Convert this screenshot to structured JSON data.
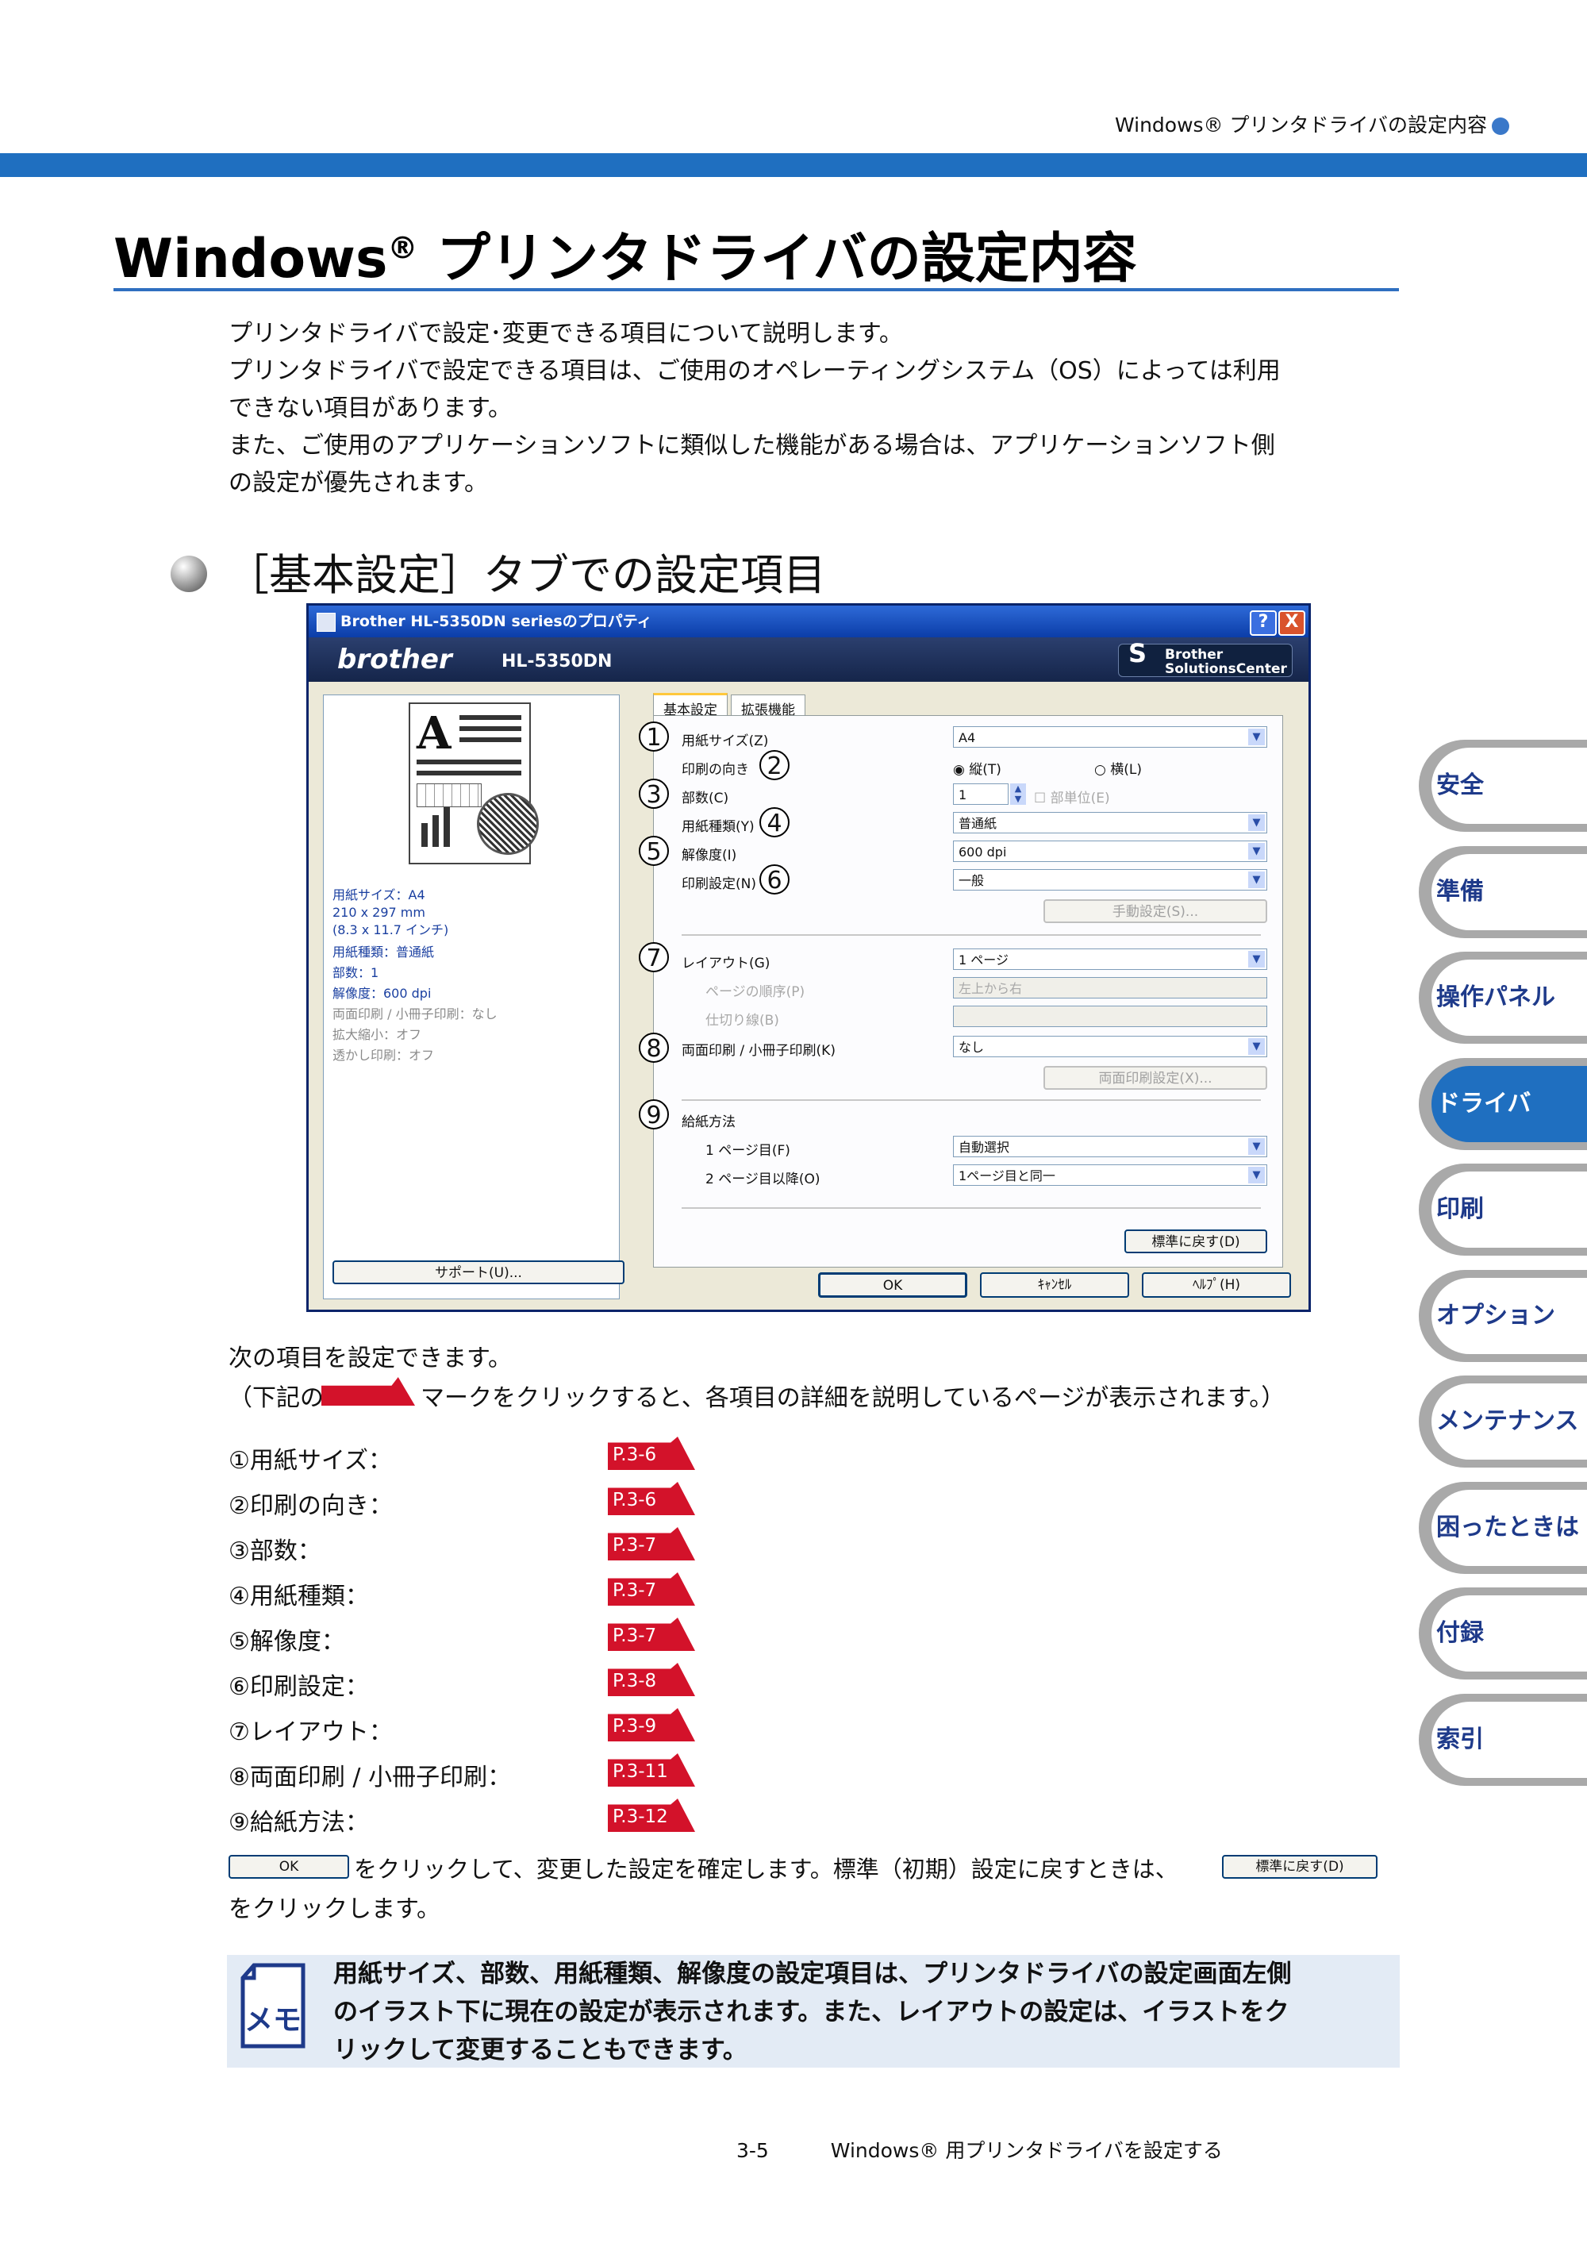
{
  "header": {
    "running_title": "Windows® プリンタドライバの設定内容"
  },
  "title": {
    "main": "Windows",
    "reg": "®",
    "rest": " プリンタドライバの設定内容"
  },
  "intro": [
    "プリンタドライバで設定･変更できる項目について説明します。",
    "プリンタドライバで設定できる項目は、ご使用のオペレーティングシステム（OS）によっては利用",
    "できない項目があります。",
    "また、ご使用のアプリケーションソフトに類似した機能がある場合は、アプリケーションソフト側",
    "の設定が優先されます。"
  ],
  "section_heading": "［基本設定］タブでの設定項目",
  "dialog": {
    "title": "Brother HL-5350DN seriesのプロパティ",
    "help_btn": "?",
    "close_btn": "X",
    "brand": "brother",
    "model": "HL-5350DN",
    "solutions_line1": "Brother",
    "solutions_line2": "SolutionsCenter",
    "tabs": [
      "基本設定",
      "拡張機能"
    ],
    "illus_letter": "A",
    "preview_info": [
      {
        "text": "用紙サイズ：A4",
        "dim": false
      },
      {
        "text": "210 x 297 mm",
        "dim": false
      },
      {
        "text": "(8.3 x 11.7 インチ)",
        "dim": false
      },
      {
        "text": "用紙種類：普通紙",
        "dim": false
      },
      {
        "text": "部数：1",
        "dim": false
      },
      {
        "text": "解像度：600 dpi",
        "dim": false
      },
      {
        "text": "両面印刷 / 小冊子印刷：なし",
        "dim": true
      },
      {
        "text": "拡大縮小：オフ",
        "dim": true
      },
      {
        "text": "透かし印刷：オフ",
        "dim": true
      }
    ],
    "support_button": "サポート(U)...",
    "fields": {
      "paper_size_label": "用紙サイズ(Z)",
      "paper_size_value": "A4",
      "orientation_label": "印刷の向き",
      "portrait": "縦(T)",
      "landscape": "横(L)",
      "copies_label": "部数(C)",
      "copies_value": "1",
      "collate": "部単位(E)",
      "media_label": "用紙種類(Y)",
      "media_value": "普通紙",
      "resolution_label": "解像度(I)",
      "resolution_value": "600 dpi",
      "print_setting_label": "印刷設定(N)",
      "print_setting_value": "一般",
      "manual_settings_btn": "手動設定(S)...",
      "layout_label": "レイアウト(G)",
      "layout_value": "1 ページ",
      "page_order_label": "ページの順序(P)",
      "page_order_value": "左上から右",
      "border_label": "仕切り線(B)",
      "border_value": "",
      "duplex_label": "両面印刷 / 小冊子印刷(K)",
      "duplex_value": "なし",
      "duplex_settings_btn": "両面印刷設定(X)...",
      "paper_source_label": "給紙方法",
      "first_page_label": "1 ページ目(F)",
      "first_page_value": "自動選択",
      "other_pages_label": "2 ページ目以降(O)",
      "other_pages_value": "1ページ目と同一",
      "default_btn": "標準に戻す(D)"
    },
    "numbers": [
      "1",
      "2",
      "3",
      "4",
      "5",
      "6",
      "7",
      "8",
      "9"
    ],
    "ok": "OK",
    "cancel": "ｷｬﾝｾﾙ",
    "help": "ﾍﾙﾌﾟ(H)"
  },
  "body": {
    "line1": "次の項目を設定できます。",
    "line2a": "（下記の",
    "line2b": "マークをクリックすると、各項目の詳細を説明しているページが表示されます。）",
    "items": [
      {
        "label": "①用紙サイズ：",
        "ref": "P.3-6"
      },
      {
        "label": "②印刷の向き：",
        "ref": "P.3-6"
      },
      {
        "label": "③部数：",
        "ref": "P.3-7"
      },
      {
        "label": "④用紙種類：",
        "ref": "P.3-7"
      },
      {
        "label": "⑤解像度：",
        "ref": "P.3-7"
      },
      {
        "label": "⑥印刷設定：",
        "ref": "P.3-8"
      },
      {
        "label": "⑦レイアウト：",
        "ref": "P.3-9"
      },
      {
        "label": "⑧両面印刷 / 小冊子印刷：",
        "ref": "P.3-11"
      },
      {
        "label": "⑨給紙方法：",
        "ref": "P.3-12"
      }
    ],
    "ok_inline": "OK",
    "confirm_text": "をクリックして、変更した設定を確定します。標準（初期）設定に戻すときは、",
    "default_inline": "標準に戻す(D)",
    "confirm_text2": "をクリックします。"
  },
  "memo": {
    "icon_label": "メモ",
    "lines": [
      "用紙サイズ、部数、用紙種類、解像度の設定項目は、プリンタドライバの設定画面左側",
      "のイラスト下に現在の設定が表示されます。また、レイアウトの設定は、イラストをク",
      "リックして変更することもできます。"
    ]
  },
  "side_tabs": [
    "安全",
    "準備",
    "操作パネル",
    "ドライバ",
    "印刷",
    "オプション",
    "メンテナンス",
    "困ったときは",
    "付録",
    "索引"
  ],
  "side_tab_active": "ドライバ",
  "footer": {
    "page": "3-5",
    "text": "Windows® 用プリンタドライバを設定する"
  },
  "colors": {
    "accent": "#1f6fc0",
    "ref_red": "#d3122a",
    "memo_bg": "#e3ebf5"
  }
}
